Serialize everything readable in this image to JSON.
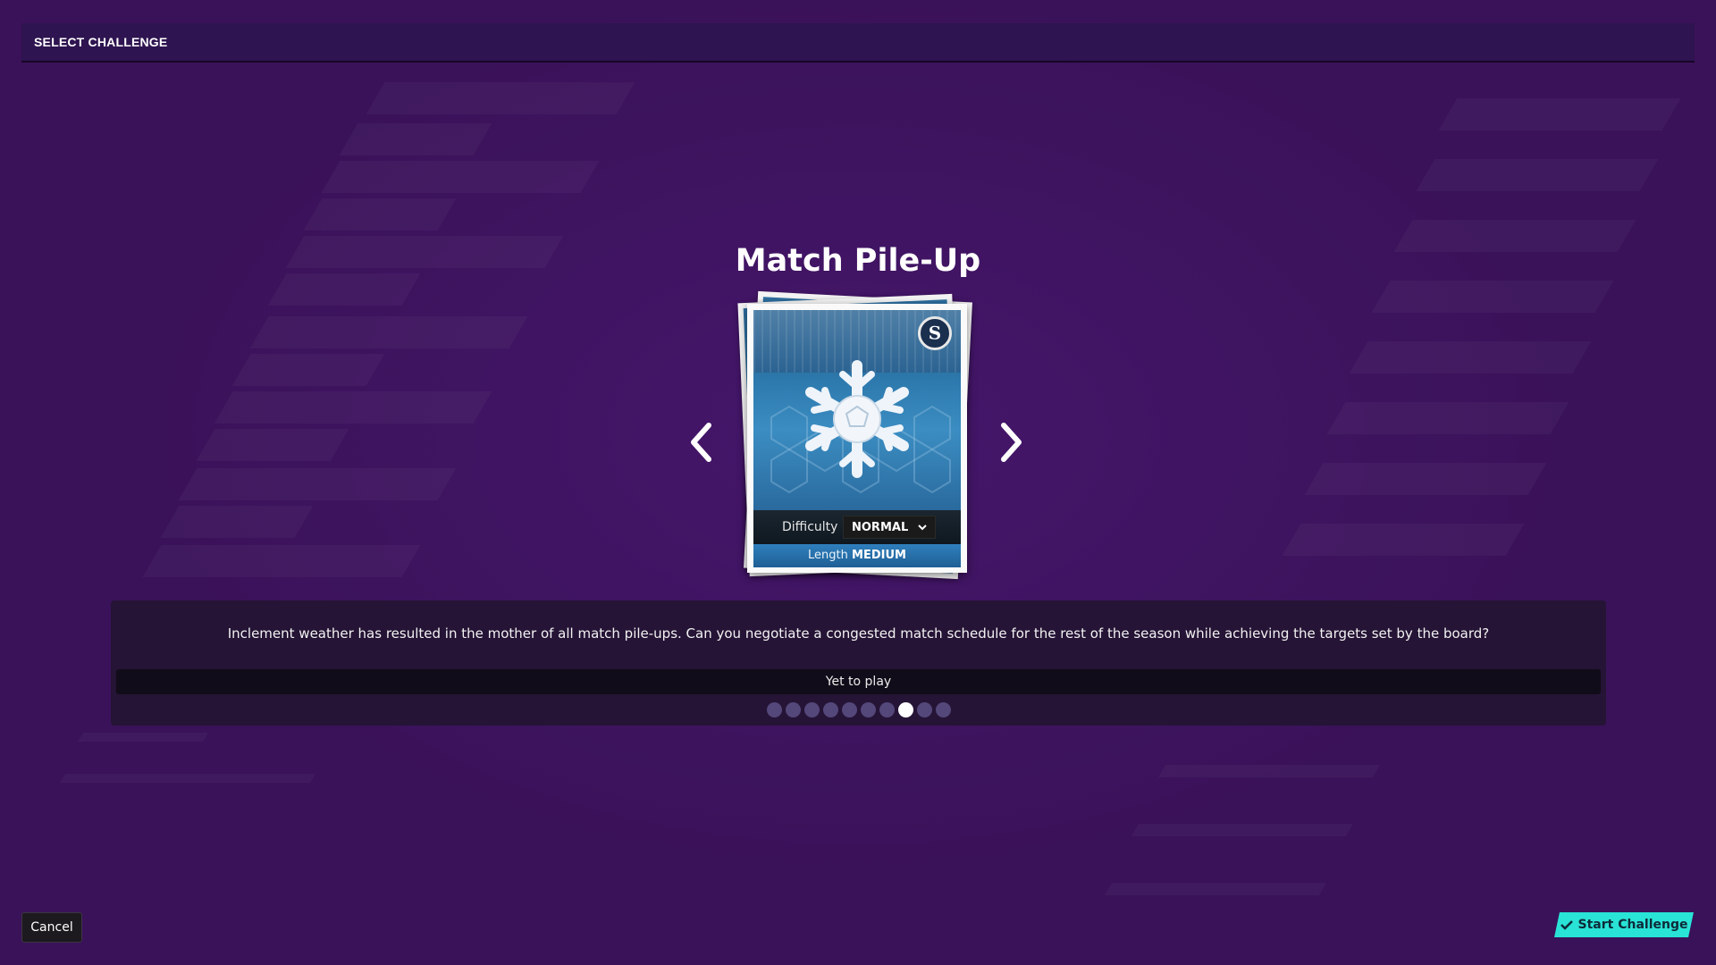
{
  "header": {
    "title": "SELECT CHALLENGE"
  },
  "challenge": {
    "title": "Match Pile-Up",
    "card": {
      "art_icon": "snowflake-icon",
      "badge_icon": "club-crest-icon",
      "badge_letter": "S",
      "difficulty_label": "Difficulty",
      "difficulty_value": "NORMAL",
      "length_label": "Length",
      "length_value": "MEDIUM"
    },
    "description": "Inclement weather has resulted in the mother of all match pile-ups. Can you negotiate a congested match schedule for the rest of the season while achieving the targets set by the board?",
    "status": "Yet to play",
    "pager": {
      "total": 10,
      "current": 8
    }
  },
  "nav": {
    "prev_icon": "chevron-left-icon",
    "next_icon": "chevron-right-icon"
  },
  "footer": {
    "cancel_label": "Cancel",
    "start_label": "Start Challenge",
    "start_icon": "checkmark-icon"
  },
  "colors": {
    "background": "#3a1259",
    "accent": "#29e3d6",
    "card_blue": "#2f7fbd"
  }
}
